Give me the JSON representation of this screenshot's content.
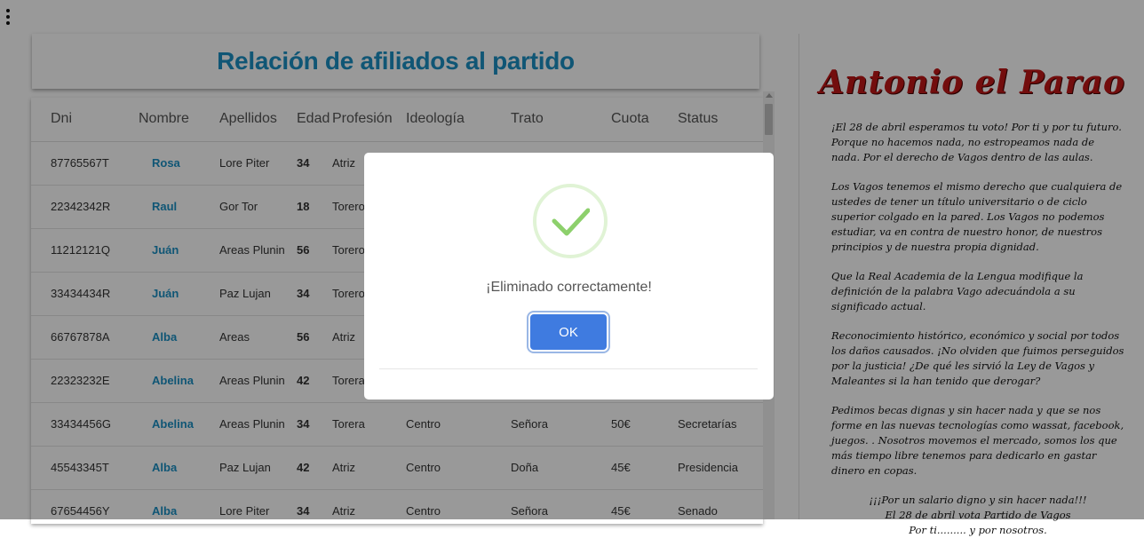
{
  "page": {
    "heading": "Relación de afiliados al partido"
  },
  "table": {
    "columns": [
      "Dni",
      "Nombre",
      "Apellidos",
      "Edad",
      "Profesión",
      "Ideología",
      "Trato",
      "Cuota",
      "Status"
    ],
    "rows": [
      {
        "dni": "87765567T",
        "nombre": "Rosa",
        "apellidos": "Lore Piter",
        "edad": "34",
        "profesion": "Atriz",
        "ideologia": "",
        "trato": "",
        "cuota": "",
        "status": ""
      },
      {
        "dni": "22342342R",
        "nombre": "Raul",
        "apellidos": "Gor Tor",
        "edad": "18",
        "profesion": "Torero",
        "ideologia": "",
        "trato": "",
        "cuota": "",
        "status": ""
      },
      {
        "dni": "11212121Q",
        "nombre": "Juán",
        "apellidos": "Areas Plunin",
        "edad": "56",
        "profesion": "Torero",
        "ideologia": "",
        "trato": "",
        "cuota": "",
        "status": ""
      },
      {
        "dni": "33434434R",
        "nombre": "Juán",
        "apellidos": "Paz Lujan",
        "edad": "34",
        "profesion": "Torero",
        "ideologia": "",
        "trato": "",
        "cuota": "",
        "status": ""
      },
      {
        "dni": "66767878A",
        "nombre": "Alba",
        "apellidos": "Areas",
        "edad": "56",
        "profesion": "Atriz",
        "ideologia": "",
        "trato": "",
        "cuota": "",
        "status": ""
      },
      {
        "dni": "22323232E",
        "nombre": "Abelina",
        "apellidos": "Areas Plunin",
        "edad": "42",
        "profesion": "Torera",
        "ideologia": "",
        "trato": "",
        "cuota": "",
        "status": ""
      },
      {
        "dni": "33434456G",
        "nombre": "Abelina",
        "apellidos": "Areas Plunin",
        "edad": "34",
        "profesion": "Torera",
        "ideologia": "Centro",
        "trato": "Señora",
        "cuota": "50€",
        "status": "Secretarías"
      },
      {
        "dni": "45543345T",
        "nombre": "Alba",
        "apellidos": "Paz Lujan",
        "edad": "42",
        "profesion": "Atriz",
        "ideologia": "Centro",
        "trato": "Doña",
        "cuota": "45€",
        "status": "Presidencia"
      },
      {
        "dni": "67654456Y",
        "nombre": "Alba",
        "apellidos": "Lore Piter",
        "edad": "34",
        "profesion": "Atriz",
        "ideologia": "Centro",
        "trato": "Señora",
        "cuota": "45€",
        "status": "Senado"
      }
    ]
  },
  "sidebar": {
    "title": "Antonio el Parao",
    "paragraphs": [
      "¡El 28 de abril esperamos tu voto! Por ti y por tu futuro. Porque no hacemos nada, no estropeamos nada de nada. Por el derecho de Vagos dentro de las aulas.",
      "Los Vagos tenemos el mismo derecho que cualquiera de ustedes de tener un título universitario o de ciclo superior colgado en la pared. Los Vagos no podemos estudiar, va en contra de nuestro honor, de nuestros principios y de nuestra propia dignidad.",
      "Que la Real Academia de la Lengua modifique la definición de la palabra Vago adecuándola a su significado actual.",
      "Reconocimiento histórico, económico y social por todos los daños causados. ¡No olviden que fuimos perseguidos por la justicia! ¿De qué les sirvió la Ley de Vagos y Maleantes si la han tenido que derogar?",
      "Pedimos becas dignas y sin hacer nada y que se nos forme en las nuevas tecnologías como wassat, facebook, juegos. . Nosotros movemos el mercado, somos los que más tiempo libre tenemos para dedicarlo en gastar dinero en copas."
    ],
    "closing": [
      "¡¡¡Por un salario digno y sin hacer nada!!!",
      "El 28 de abril vota Partido de Vagos",
      "Por ti......... y por nosotros."
    ]
  },
  "modal": {
    "message": "¡Eliminado correctamente!",
    "ok_label": "OK",
    "icon": "success-check-icon",
    "check_color": "#8dd06c"
  },
  "colors": {
    "accent": "#1b8fc4",
    "button": "#3f7be0",
    "sidebar_title": "#c01616"
  }
}
